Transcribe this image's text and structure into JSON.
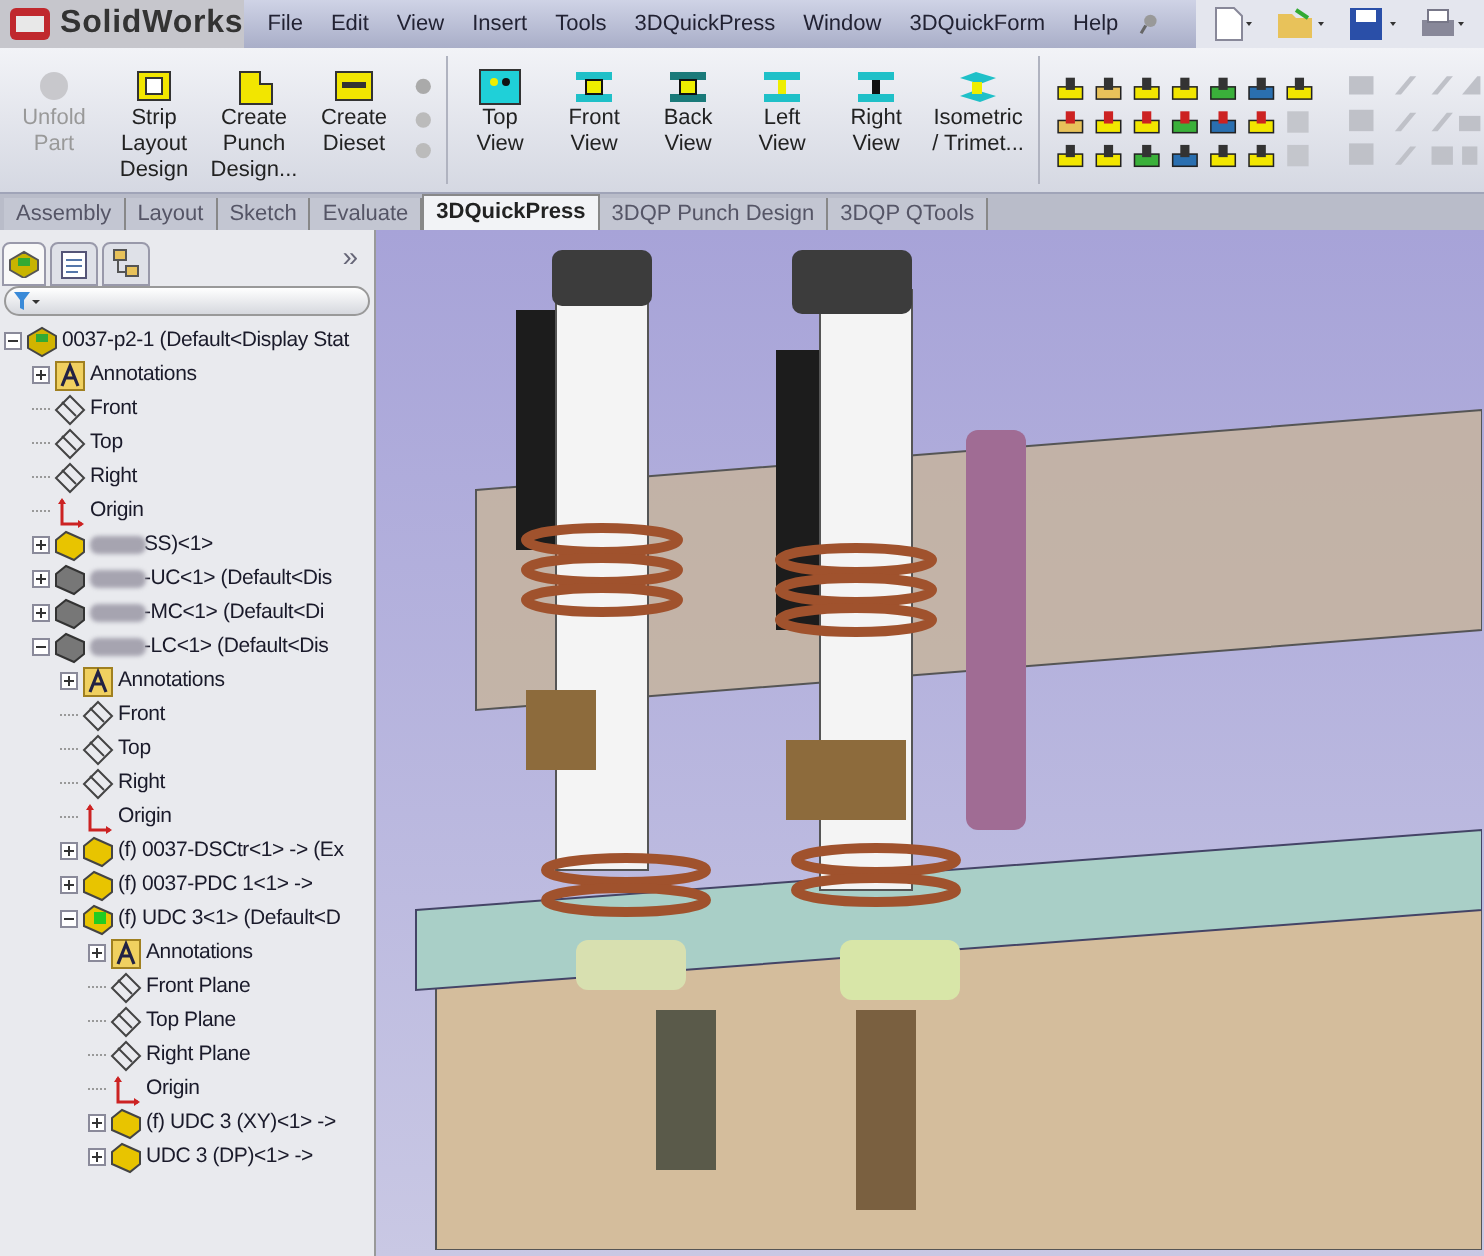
{
  "app": {
    "logo": "SolidWorks"
  },
  "menu": [
    "File",
    "Edit",
    "View",
    "Insert",
    "Tools",
    "3DQuickPress",
    "Window",
    "3DQuickForm",
    "Help"
  ],
  "toolbar": [
    {
      "label": "Unfold Part",
      "kind": "unfold",
      "disabled": true
    },
    {
      "label": "Strip Layout Design",
      "kind": "strip",
      "disabled": false
    },
    {
      "label": "Create Punch Design...",
      "kind": "punch",
      "disabled": false
    },
    {
      "label": "Create Dieset",
      "kind": "dieset",
      "disabled": false
    },
    {
      "label": "Top View",
      "kind": "top",
      "disabled": false
    },
    {
      "label": "Front View",
      "kind": "front",
      "disabled": false
    },
    {
      "label": "Back View",
      "kind": "back",
      "disabled": false
    },
    {
      "label": "Left View",
      "kind": "left",
      "disabled": false
    },
    {
      "label": "Right View",
      "kind": "right",
      "disabled": false
    },
    {
      "label": "Isometric / Trimet...",
      "kind": "iso",
      "disabled": false
    }
  ],
  "tabs": [
    {
      "label": "Assembly",
      "selected": false
    },
    {
      "label": "Layout",
      "selected": false
    },
    {
      "label": "Sketch",
      "selected": false
    },
    {
      "label": "Evaluate",
      "selected": false
    },
    {
      "label": "3DQuickPress",
      "selected": true
    },
    {
      "label": "3DQP Punch Design",
      "selected": false
    },
    {
      "label": "3DQP QTools",
      "selected": false
    }
  ],
  "panel": {
    "more": "»",
    "tree": [
      {
        "label": "0037-p2-1  (Default<Display Stat",
        "kind": "assembly",
        "expanded": true,
        "children": [
          {
            "label": "Annotations",
            "kind": "annotations",
            "expanded": false
          },
          {
            "label": "Front",
            "kind": "plane"
          },
          {
            "label": "Top",
            "kind": "plane"
          },
          {
            "label": "Right",
            "kind": "plane"
          },
          {
            "label": "Origin",
            "kind": "origin"
          },
          {
            "label": "SS)<1>",
            "kind": "part",
            "blurred": true,
            "expanded": false
          },
          {
            "label": "-UC<1> (Default<Dis",
            "kind": "gray",
            "blurred": true,
            "expanded": false
          },
          {
            "label": "-MC<1> (Default<Di",
            "kind": "gray",
            "blurred": true,
            "expanded": false
          },
          {
            "label": "-LC<1> (Default<Dis",
            "kind": "gray",
            "blurred": true,
            "expanded": true,
            "children": [
              {
                "label": "Annotations",
                "kind": "annotations",
                "expanded": false
              },
              {
                "label": "Front",
                "kind": "plane"
              },
              {
                "label": "Top",
                "kind": "plane"
              },
              {
                "label": "Right",
                "kind": "plane"
              },
              {
                "label": "Origin",
                "kind": "origin"
              },
              {
                "label": "(f) 0037-DSCtr<1> -> (Ex",
                "kind": "part",
                "expanded": false
              },
              {
                "label": "(f) 0037-PDC 1<1> ->",
                "kind": "part",
                "expanded": false
              },
              {
                "label": "(f) UDC 3<1> (Default<D",
                "kind": "green",
                "expanded": true,
                "children": [
                  {
                    "label": "Annotations",
                    "kind": "annotations",
                    "expanded": false
                  },
                  {
                    "label": "Front Plane",
                    "kind": "plane"
                  },
                  {
                    "label": "Top Plane",
                    "kind": "plane"
                  },
                  {
                    "label": "Right Plane",
                    "kind": "plane"
                  },
                  {
                    "label": "Origin",
                    "kind": "origin"
                  },
                  {
                    "label": "(f) UDC 3 (XY)<1> ->",
                    "kind": "part",
                    "expanded": false
                  },
                  {
                    "label": "UDC 3 (DP)<1> ->",
                    "kind": "part",
                    "expanded": false
                  }
                ]
              }
            ]
          }
        ]
      }
    ]
  }
}
